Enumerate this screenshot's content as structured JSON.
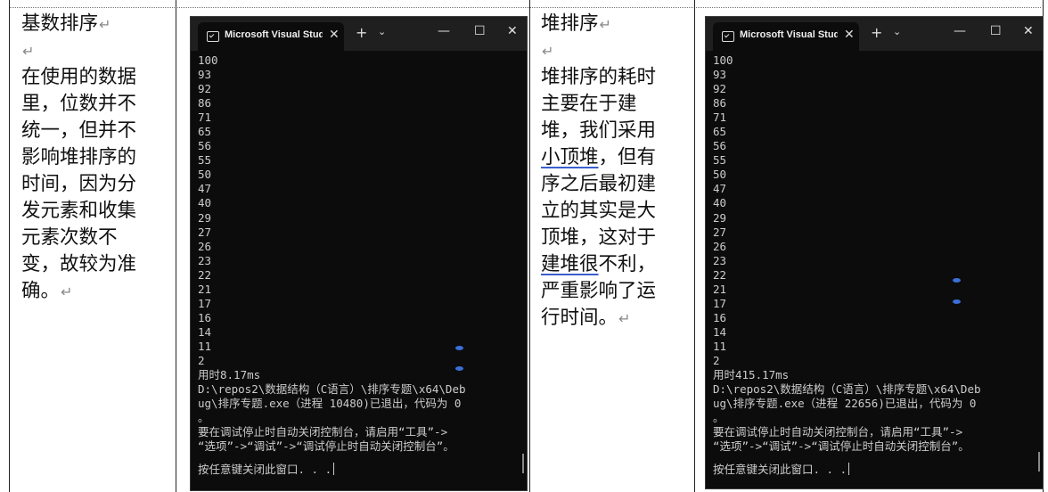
{
  "left_text": {
    "lines": [
      "基数排序",
      "",
      "在使用的数据",
      "里，位数并不",
      "统一，但并不",
      "影响堆排序的",
      "时间，因为分",
      "发元素和收集",
      "元素次数不",
      "变，故较为准",
      "确。"
    ]
  },
  "right_text": {
    "lines": [
      {
        "parts": [
          {
            "t": "堆排序"
          }
        ],
        "ret": true
      },
      {
        "parts": [],
        "ret": true
      },
      {
        "parts": [
          {
            "t": "堆排序的耗时"
          }
        ]
      },
      {
        "parts": [
          {
            "t": "主要在于建"
          }
        ]
      },
      {
        "parts": [
          {
            "t": "堆，我们采用"
          }
        ]
      },
      {
        "parts": [
          {
            "t": "小顶堆",
            "u": true
          },
          {
            "t": "，但有"
          }
        ]
      },
      {
        "parts": [
          {
            "t": "序之后最初建"
          }
        ]
      },
      {
        "parts": [
          {
            "t": "立的其实是大"
          }
        ]
      },
      {
        "parts": [
          {
            "t": "顶堆，这对于"
          }
        ]
      },
      {
        "parts": [
          {
            "t": "建堆很",
            "u": true
          },
          {
            "t": "不利，"
          }
        ]
      },
      {
        "parts": [
          {
            "t": "严重影响了运"
          }
        ]
      },
      {
        "parts": [
          {
            "t": "行时间。"
          }
        ],
        "ret": true
      }
    ]
  },
  "terminal_left": {
    "tab_title": "Microsoft Visual Studio Debug Console",
    "close_glyph": "✕",
    "new_tab_glyph": "+",
    "dropdown_glyph": "⌄",
    "minimize_glyph": "—",
    "maximize_glyph": "☐",
    "window_close_glyph": "✕",
    "output_lines": [
      "100",
      "93",
      "92",
      "86",
      "71",
      "65",
      "56",
      "55",
      "50",
      "47",
      "40",
      "29",
      "27",
      "26",
      "23",
      "22",
      "21",
      "17",
      "16",
      "14",
      "11",
      "2",
      "用时8.17ms",
      "D:\\repos2\\数据结构（C语言）\\排序专题\\x64\\Deb",
      "ug\\排序专题.exe（进程 10480)已退出，代码为 0",
      "。",
      "要在调试停止时自动关闭控制台，请启用“工具”->",
      "“选项”->“调试”->“调试停止时自动关闭控制台”。"
    ],
    "prompt": "按任意键关闭此窗口. . ."
  },
  "terminal_right": {
    "tab_title": "Microsoft Visual Studio Debug Console",
    "close_glyph": "✕",
    "new_tab_glyph": "+",
    "dropdown_glyph": "⌄",
    "minimize_glyph": "—",
    "maximize_glyph": "☐",
    "window_close_glyph": "✕",
    "output_lines": [
      "100",
      "93",
      "92",
      "86",
      "71",
      "65",
      "56",
      "55",
      "50",
      "47",
      "40",
      "29",
      "27",
      "26",
      "23",
      "22",
      "21",
      "17",
      "16",
      "14",
      "11",
      "2",
      "用时415.17ms",
      "D:\\repos2\\数据结构（C语言）\\排序专题\\x64\\Deb",
      "ug\\排序专题.exe（进程 22656)已退出，代码为 0",
      "。",
      "要在调试停止时自动关闭控制台，请启用“工具”->",
      "“选项”->“调试”->“调试停止时自动关闭控制台”。"
    ],
    "prompt": "按任意键关闭此窗口. . ."
  },
  "paragraph_mark": "↵"
}
